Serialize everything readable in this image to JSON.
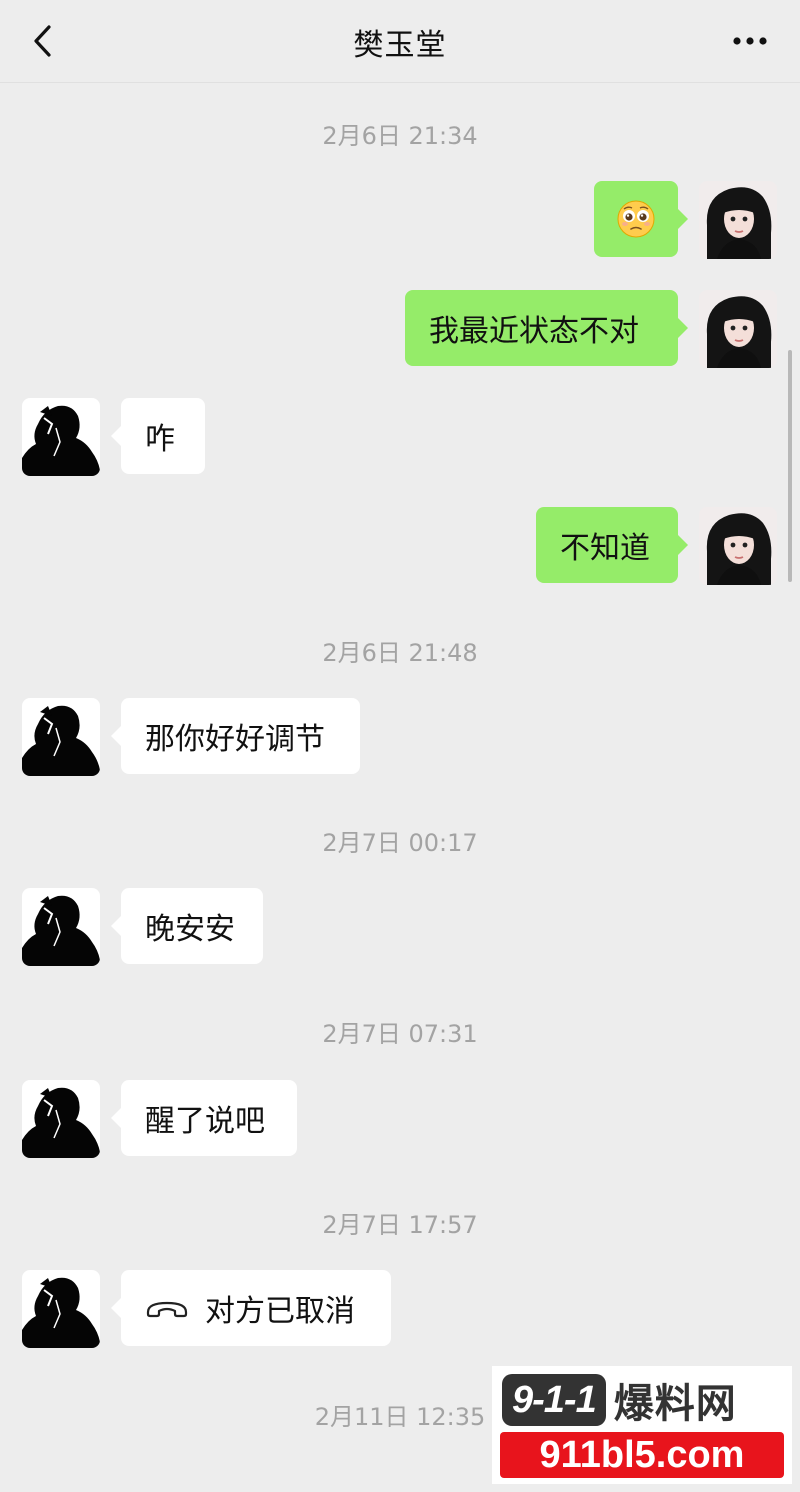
{
  "header": {
    "title": "樊玉堂",
    "back_icon": "chevron-left-icon",
    "more_icon": "more-dots-icon"
  },
  "messages": [
    {
      "type": "timestamp",
      "text": "2月6日 21:34"
    },
    {
      "type": "out",
      "emoji": "pleading-face-emoji"
    },
    {
      "type": "out",
      "text": "我最近状态不对"
    },
    {
      "type": "in",
      "text": "咋"
    },
    {
      "type": "out",
      "text": "不知道"
    },
    {
      "type": "timestamp",
      "text": "2月6日 21:48"
    },
    {
      "type": "in",
      "text": "那你好好调节"
    },
    {
      "type": "timestamp",
      "text": "2月7日 00:17"
    },
    {
      "type": "in",
      "text": "晚安安"
    },
    {
      "type": "timestamp",
      "text": "2月7日 07:31"
    },
    {
      "type": "in",
      "text": "醒了说吧"
    },
    {
      "type": "timestamp",
      "text": "2月7日 17:57"
    },
    {
      "type": "in",
      "icon": "voice-call-icon",
      "text": "对方已取消"
    },
    {
      "type": "timestamp",
      "text": "2月11日 12:35"
    }
  ],
  "watermark": {
    "logo": "9-1-1",
    "brand": "爆料网",
    "url": "911bl5.com"
  },
  "colors": {
    "background": "#ededed",
    "bubble_out": "#95ec69",
    "bubble_in": "#ffffff",
    "timestamp": "#a3a3a3",
    "watermark_red": "#e8141c"
  }
}
